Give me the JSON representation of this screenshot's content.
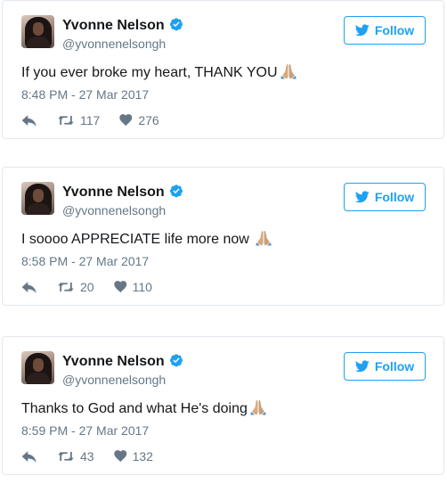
{
  "colors": {
    "accent": "#1da1f2",
    "muted": "#657786",
    "text": "#14171a",
    "border": "#e1e8ed"
  },
  "tweets": [
    {
      "name": "Yvonne Nelson",
      "handle": "@yvonnenelsongh",
      "follow_label": "Follow",
      "text": "If you ever broke my heart, THANK YOU",
      "emoji": "folded-hands-icon",
      "time": "8:48 PM - 27 Mar 2017",
      "retweets": "117",
      "likes": "276"
    },
    {
      "name": "Yvonne Nelson",
      "handle": "@yvonnenelsongh",
      "follow_label": "Follow",
      "text": "I soooo APPRECIATE life more now ",
      "emoji": "folded-hands-icon",
      "time": "8:58 PM - 27 Mar 2017",
      "retweets": "20",
      "likes": "110"
    },
    {
      "name": "Yvonne Nelson",
      "handle": "@yvonnenelsongh",
      "follow_label": "Follow",
      "text": "Thanks to God and what He's doing",
      "emoji": "folded-hands-icon",
      "time": "8:59 PM - 27 Mar 2017",
      "retweets": "43",
      "likes": "132"
    }
  ]
}
